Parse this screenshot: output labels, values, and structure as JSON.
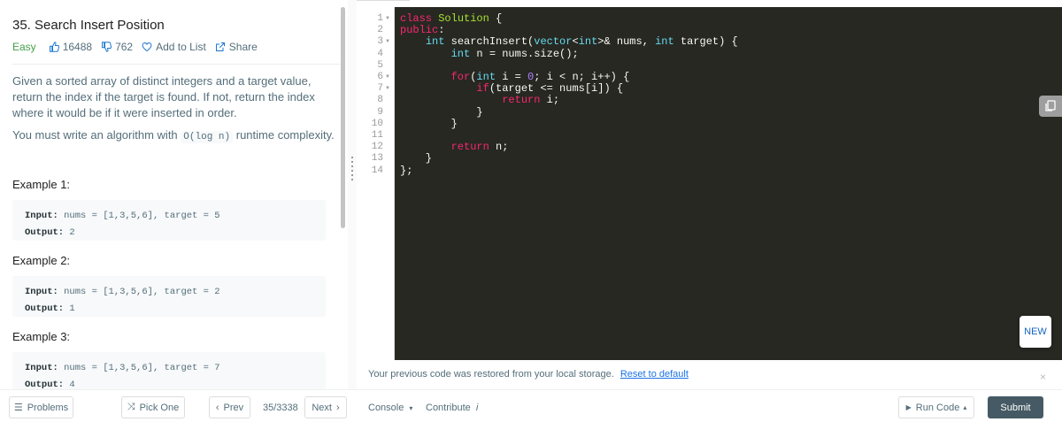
{
  "problem": {
    "title": "35. Search Insert Position",
    "difficulty": "Easy",
    "likes": "16488",
    "dislikes": "762",
    "add_to_list": "Add to List",
    "share": "Share",
    "description": "Given a sorted array of distinct integers and a target value, return the index if the target is found. If not, return the index where it would be if it were inserted in order.",
    "complexity_prefix": "You must write an algorithm with",
    "complexity_code": "O(log n)",
    "complexity_suffix": "runtime complexity.",
    "examples": [
      {
        "title": "Example 1:",
        "input_label": "Input:",
        "input": "nums = [1,3,5,6], target = 5",
        "output_label": "Output:",
        "output": "2"
      },
      {
        "title": "Example 2:",
        "input_label": "Input:",
        "input": "nums = [1,3,5,6], target = 2",
        "output_label": "Output:",
        "output": "1"
      },
      {
        "title": "Example 3:",
        "input_label": "Input:",
        "input": "nums = [1,3,5,6], target = 7",
        "output_label": "Output:",
        "output": "4"
      }
    ]
  },
  "editor": {
    "line_numbers": [
      "1",
      "2",
      "3",
      "4",
      "5",
      "6",
      "7",
      "8",
      "9",
      "10",
      "11",
      "12",
      "13",
      "14"
    ],
    "code_lines": [
      "class Solution {",
      "public:",
      "    int searchInsert(vector<int>& nums, int target) {",
      "        int n = nums.size();",
      "",
      "        for(int i = 0; i < n; i++) {",
      "            if(target <= nums[i]) {",
      "                return i;",
      "            }",
      "        }",
      "",
      "        return n;",
      "    }",
      "};"
    ],
    "new_badge": "NEW",
    "restore_message": "Your previous code was restored from your local storage.",
    "reset_link": "Reset to default",
    "close": "×"
  },
  "bottom_bar": {
    "problems": "Problems",
    "pick_one": "Pick One",
    "prev": "Prev",
    "page_counter": "35/3338",
    "next": "Next",
    "console": "Console",
    "contribute": "Contribute",
    "run_code": "Run Code",
    "submit": "Submit"
  },
  "colors": {
    "editor_bg": "#272822",
    "easy": "#43a047",
    "submit_bg": "#455a64",
    "link": "#1a73e8"
  }
}
